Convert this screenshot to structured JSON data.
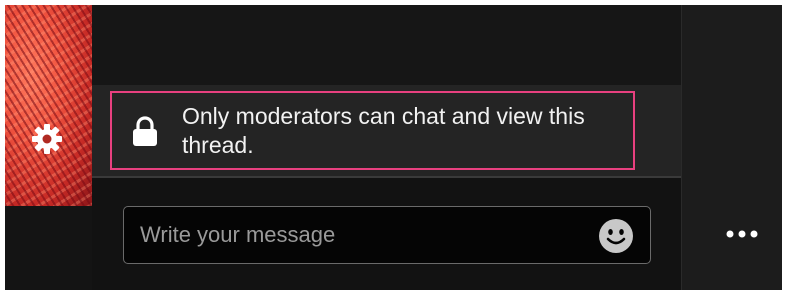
{
  "notice": {
    "text": "Only moderators can chat and view this thread.",
    "border_color": "#e8407f"
  },
  "composer": {
    "placeholder": "Write your message",
    "value": ""
  },
  "icons": {
    "settings": "gear-icon",
    "lock": "lock-icon",
    "emoji": "emoji-icon",
    "more": "more-options-icon"
  },
  "colors": {
    "background": "#0f0f0f",
    "notice_strip": "#242424",
    "text": "#f2f2f2",
    "placeholder": "#9a9a9a"
  }
}
